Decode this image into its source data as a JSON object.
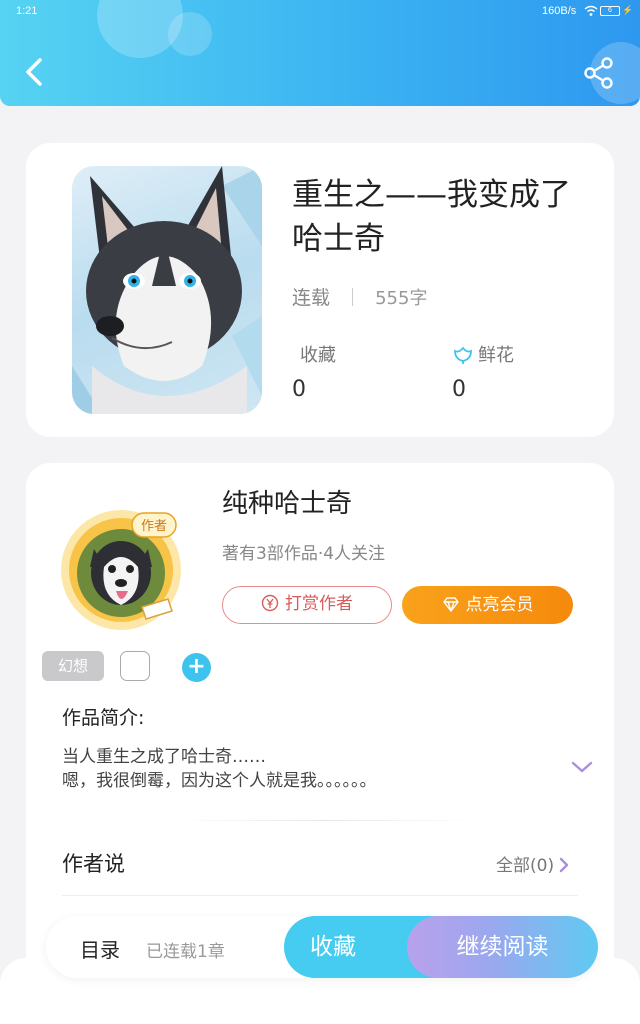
{
  "status_bar": {
    "time": "1:21",
    "network_speed": "160B/s",
    "battery": "6"
  },
  "book": {
    "title": "重生之——我变成了哈士奇",
    "status": "连载",
    "word_count": "555字",
    "favorites_label": "收藏",
    "favorites_value": "0",
    "flowers_label": "鲜花",
    "flowers_value": "0"
  },
  "author": {
    "name": "纯种哈士奇",
    "stats": "著有3部作品·4人关注",
    "badge_text": "作者",
    "tip_label": "打赏作者",
    "vip_label": "点亮会员"
  },
  "tags": {
    "genre": "幻想"
  },
  "intro": {
    "label": "作品简介:",
    "line1": "当人重生之成了哈士奇……",
    "line2": "嗯，我很倒霉，因为这个人就是我。。。。。。"
  },
  "author_says": {
    "label": "作者说",
    "all_label": "全部(0)"
  },
  "bottom_bar": {
    "toc_label": "目录",
    "chapters": "已连载1章",
    "collect_label": "收藏",
    "read_label": "继续阅读"
  },
  "colors": {
    "header": "#3bb3f2",
    "accent": "#45ccf0",
    "vip": "#f6890c",
    "tip": "#d85b5b"
  },
  "icons": [
    "back-arrow-icon",
    "share-icon",
    "flower-icon",
    "yen-icon",
    "diamond-icon",
    "plus-icon",
    "chevron-down-icon",
    "chevron-right-icon"
  ]
}
